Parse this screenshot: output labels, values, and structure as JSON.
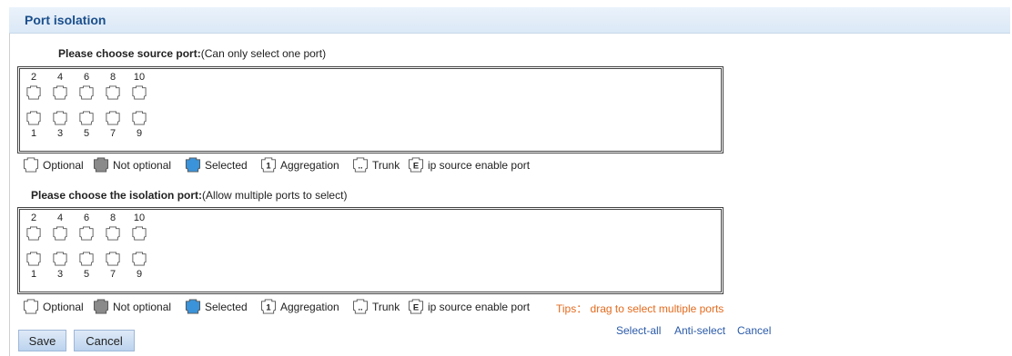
{
  "header": {
    "title": "Port isolation"
  },
  "source": {
    "heading_bold": "Please choose source port:",
    "heading_rest": "(Can only select one port)",
    "top_ports": [
      "2",
      "4",
      "6",
      "8",
      "10"
    ],
    "bottom_ports": [
      "1",
      "3",
      "5",
      "7",
      "9"
    ]
  },
  "isolation": {
    "heading_bold": "Please choose the isolation port:",
    "heading_rest": "(Allow multiple ports to select)",
    "top_ports": [
      "2",
      "4",
      "6",
      "8",
      "10"
    ],
    "bottom_ports": [
      "1",
      "3",
      "5",
      "7",
      "9"
    ]
  },
  "legend": {
    "optional": "Optional",
    "not_optional": "Not optional",
    "selected": "Selected",
    "aggregation": "Aggregation",
    "aggregation_mark": "1",
    "trunk": "Trunk",
    "trunk_mark": "..",
    "ip_source": "ip source enable port",
    "ip_source_mark": "E"
  },
  "tips": "Tips： drag to select multiple ports",
  "links": {
    "select_all": "Select-all",
    "anti_select": "Anti-select",
    "cancel": "Cancel"
  },
  "buttons": {
    "save": "Save",
    "cancel": "Cancel"
  },
  "colors": {
    "not_optional": "#8a8a8a",
    "selected": "#3b93d9",
    "tips": "#e46b1e",
    "link": "#2a5aa8"
  }
}
